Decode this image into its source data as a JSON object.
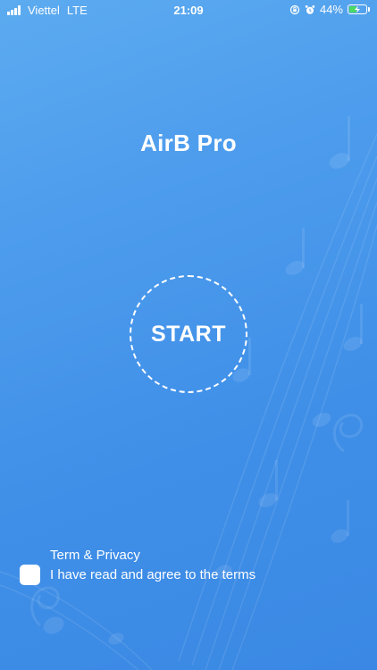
{
  "status_bar": {
    "carrier": "Viettel",
    "network": "LTE",
    "time": "21:09",
    "battery_percent": "44%",
    "battery_level": 0.44,
    "battery_color": "#4cd964",
    "icons": [
      "signal-icon",
      "rotation-lock-icon",
      "alarm-icon",
      "battery-charging-icon"
    ]
  },
  "app": {
    "title": "AirB Pro"
  },
  "start_button": {
    "label": "START"
  },
  "terms": {
    "link_label": "Term & Privacy",
    "agree_text": "I have read and agree to the terms",
    "checked": false
  },
  "theme": {
    "background_top": "#5cabf0",
    "background_bottom": "#3a88e3",
    "foreground": "#ffffff"
  }
}
